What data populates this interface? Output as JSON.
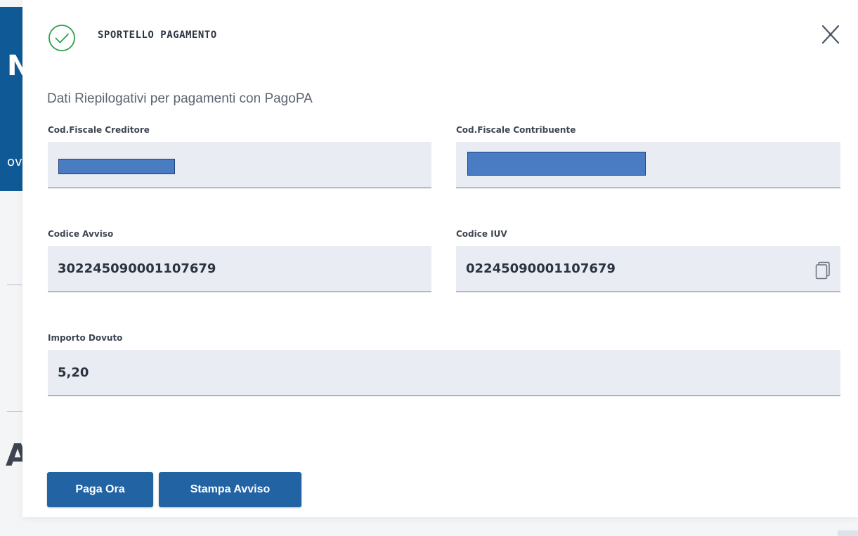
{
  "background": {
    "banner_letter": "N",
    "banner_fragment": "ov",
    "heading_fragment": "A"
  },
  "modal": {
    "title": "SPORTELLO PAGAMENTO",
    "subtitle": "Dati Riepilogativi per pagamenti con PagoPA",
    "close_icon": "close-icon",
    "status_icon": "check-circle-icon"
  },
  "fields": {
    "cod_fiscale_creditore": {
      "label": "Cod.Fiscale Creditore"
    },
    "cod_fiscale_contribuente": {
      "label": "Cod.Fiscale Contribuente"
    },
    "codice_avviso": {
      "label": "Codice Avviso",
      "value": "302245090001107679"
    },
    "codice_iuv": {
      "label": "Codice IUV",
      "value": "02245090001107679",
      "action_icon": "copy-icon"
    },
    "importo_dovuto": {
      "label": "Importo Dovuto",
      "value": "5,20"
    }
  },
  "buttons": {
    "paga_ora": "Paga Ora",
    "stampa_avviso": "Stampa Avviso"
  },
  "colors": {
    "primary": "#2263a4",
    "banner": "#0f5a96",
    "success": "#2e9e4f",
    "field_bg": "#e9edf3",
    "redaction": "#4a7cc4"
  }
}
